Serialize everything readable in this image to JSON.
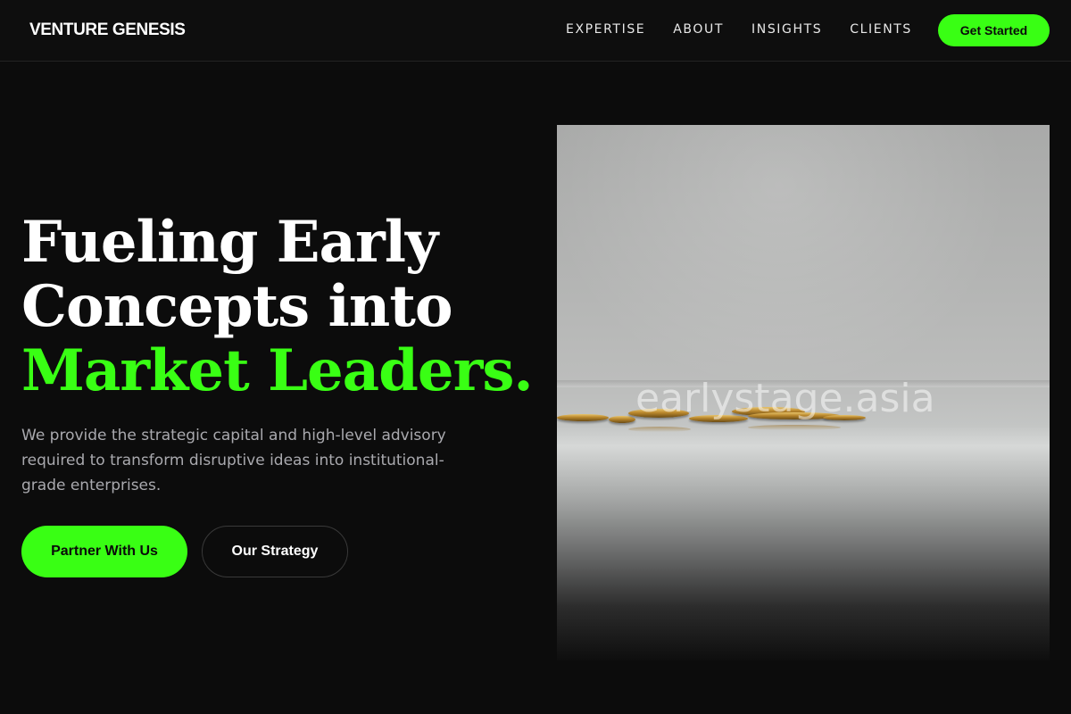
{
  "header": {
    "logo": "VENTURE GENESIS",
    "nav": [
      "EXPERTISE",
      "ABOUT",
      "INSIGHTS",
      "CLIENTS"
    ],
    "cta_label": "Get Started"
  },
  "hero": {
    "title_line1": "Fueling Early",
    "title_line2": "Concepts into",
    "title_accent": "Market Leaders.",
    "subtitle": "We provide the strategic capital and high-level advisory required to transform disruptive ideas into institutional-grade enterprises.",
    "primary_button": "Partner With Us",
    "secondary_button": "Our Strategy",
    "image_watermark": "earlystage.asia"
  },
  "colors": {
    "accent": "#39ff14",
    "background": "#0c0c0c",
    "text_muted": "#a9a9ae"
  }
}
